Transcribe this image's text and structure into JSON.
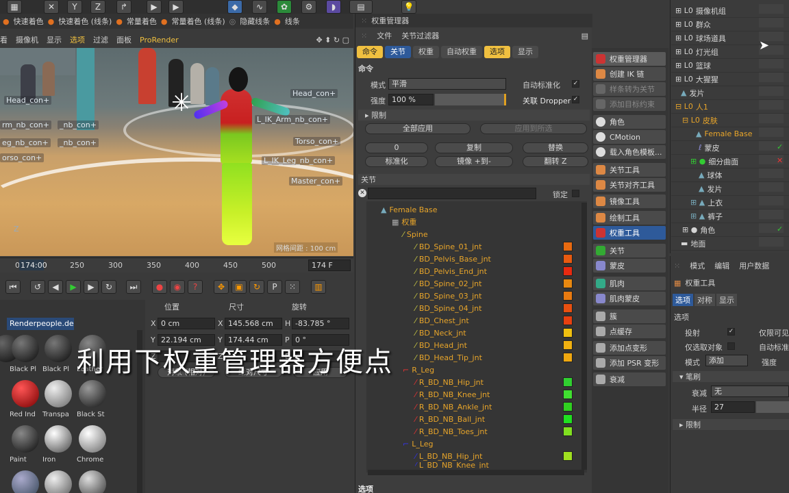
{
  "toolbar2": {
    "a": "快速着色",
    "b": "快速着色 (线条)",
    "c": "常量着色",
    "d": "常量着色 (线条)",
    "e": "隐藏线条",
    "f": "线条"
  },
  "vpmenu": [
    "看",
    "摄像机",
    "显示",
    "选项",
    "过滤",
    "面板",
    "ProRender"
  ],
  "viewport": {
    "labels": [
      "Head_con+",
      "Head_con+",
      "L_IK_Arm_nb_con+",
      "rm_nb_con+",
      "_nb_con+",
      "eg_nb_con+",
      "_nb_con+",
      "Torso_con+",
      "orso_con+",
      "L_IK_Leg_nb_con+",
      "Master_con+"
    ],
    "axis": "Z",
    "grid": "网格间距 : 100 cm"
  },
  "timeline": {
    "start": "0",
    "cur": "174:00",
    "ticks": [
      "250",
      "300",
      "350",
      "400",
      "450",
      "500"
    ],
    "end": "174 F"
  },
  "browser": {
    "tab": "Renderpeople.de",
    "mats": [
      "Black Pl",
      "Black Pl",
      "Leather",
      "Red Ind",
      "Transpa",
      "Black St",
      "Paint",
      "Iron",
      "Chrome"
    ]
  },
  "coords": {
    "h1": "位置",
    "h2": "尺寸",
    "h3": "旋转",
    "x": "0 cm",
    "sx": "145.568 cm",
    "h": "-83.785 °",
    "y": "22.194 cm",
    "sy": "174.44 cm",
    "p": "0 °",
    "b1": "对象 (相对)",
    "b2": "绝对尺寸",
    "b3": "应用"
  },
  "wm": {
    "title": "权重管理器",
    "menu1": "文件",
    "menu2": "关节过滤器",
    "tabs": [
      "命令",
      "关节",
      "权重",
      "自动权重",
      "选项",
      "显示"
    ],
    "section": "命令",
    "mode_label": "模式",
    "mode_val": "平滑",
    "auto_label": "自动标准化",
    "str_label": "强度",
    "str_val": "100 %",
    "dropper": "关联 Dropper",
    "limit": "限制",
    "apply_all": "全部应用",
    "apply_sel": "应用到所选",
    "zero": "0",
    "copy": "复制",
    "replace": "替换",
    "normalize": "标准化",
    "mirror": "镜像 +到-",
    "flip": "翻转 Z",
    "joints": "关节",
    "lock": "锁定",
    "bottom": "选项"
  },
  "tree": {
    "root": "Female Base",
    "weight": "权重",
    "spine": "Spine",
    "items": [
      "BD_Spine_01_jnt",
      "BD_Pelvis_Base_jnt",
      "BD_Pelvis_End_jnt",
      "BD_Spine_02_jnt",
      "BD_Spine_03_jnt",
      "BD_Spine_04_jnt",
      "BD_Chest_jnt",
      "BD_Neck_jnt",
      "BD_Head_jnt",
      "BD_Head_Tip_jnt"
    ],
    "rleg": "R_Leg",
    "ritems": [
      "R_BD_NB_Hip_jnt",
      "R_BD_NB_Knee_jnt",
      "R_BD_NB_Ankle_jnt",
      "R_BD_NB_Ball_jnt",
      "R_BD_NB_Toes_jnt"
    ],
    "lleg": "L_Leg",
    "litems": [
      "L_BD_NB_Hip_jnt",
      "L_BD_NB_Knee_jnt"
    ]
  },
  "tools": [
    "权重管理器",
    "创建 IK 链",
    "样条转为关节",
    "添加目标约束",
    "角色",
    "CMotion",
    "载入角色模板...",
    "关节工具",
    "关节对齐工具",
    "镜像工具",
    "绘制工具",
    "权重工具",
    "关节",
    "蒙皮",
    "肌肉",
    "肌肉蒙皮",
    "簇",
    "点缓存",
    "添加点变形",
    "添加 PSR 变形",
    "衰减"
  ],
  "objects": [
    "摄像机组",
    "群众",
    "球场道具",
    "灯光组",
    "篮球",
    "大猩猩",
    "发片",
    "人1",
    "皮肤",
    "Female Base",
    "蒙皮",
    "细分曲面",
    "球体",
    "发片",
    "上衣",
    "裤子",
    "角色",
    "地面"
  ],
  "attr": {
    "menu": [
      "模式",
      "编辑",
      "用户数据"
    ],
    "title": "权重工具",
    "tabs": [
      "选项",
      "对称",
      "显示"
    ],
    "sec": "选项",
    "project": "投射",
    "only_vis": "仅限可见",
    "only_sel": "仅选取对象",
    "auto_norm": "自动标准",
    "mode": "模式",
    "mode_val": "添加",
    "strength": "强度",
    "brush": "笔刷",
    "falloff": "衰减",
    "falloff_val": "无",
    "radius": "半径",
    "radius_val": "27",
    "limit": "限制"
  },
  "subtitle": "利用下权重管理器方便点"
}
